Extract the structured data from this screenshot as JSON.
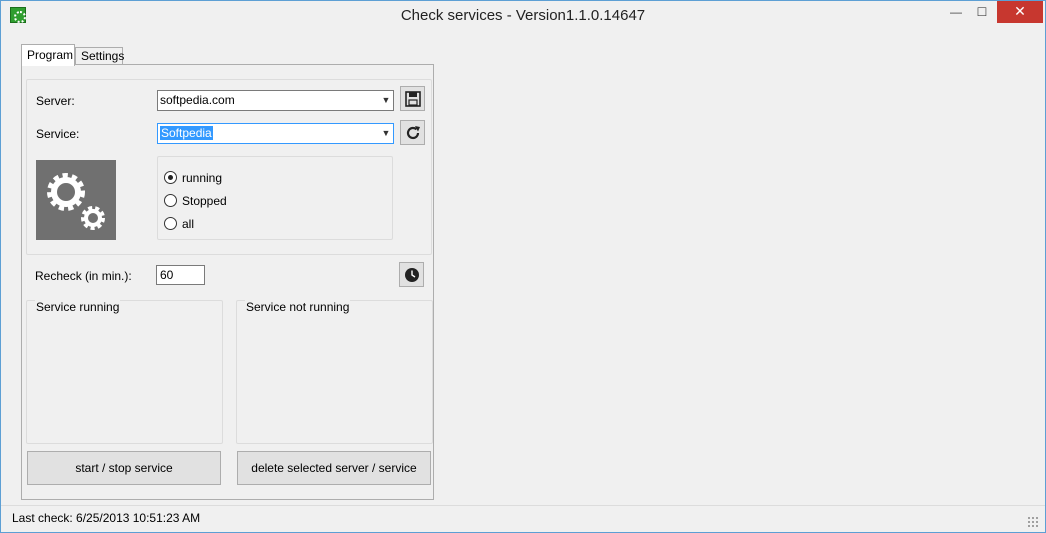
{
  "window": {
    "title": "Check services - Version1.1.0.14647",
    "minimize_label": "—",
    "maximize_label": "☐",
    "close_label": "✕"
  },
  "tabs": [
    {
      "label": "Program",
      "selected": true
    },
    {
      "label": "Settings",
      "selected": false
    }
  ],
  "program": {
    "server_label": "Server:",
    "server_value": "softpedia.com",
    "service_label": "Service:",
    "service_value": "Softpedia",
    "save_icon": "save-icon",
    "refresh_icon": "refresh-icon",
    "filter_options": [
      {
        "label": "running",
        "checked": true
      },
      {
        "label": "Stopped",
        "checked": false
      },
      {
        "label": "all",
        "checked": false
      }
    ],
    "recheck_label": "Recheck (in min.):",
    "recheck_value": "60",
    "clock_icon": "clock-icon",
    "running_panel_title": "Service running",
    "not_running_panel_title": "Service not running",
    "start_stop_label": "start / stop service",
    "delete_label": "delete selected server / service"
  },
  "status": {
    "text": "Last check: 6/25/2013 10:51:23 AM"
  },
  "colors": {
    "accent": "#3399ff",
    "close": "#c7372f",
    "gear_bg": "#707070"
  }
}
